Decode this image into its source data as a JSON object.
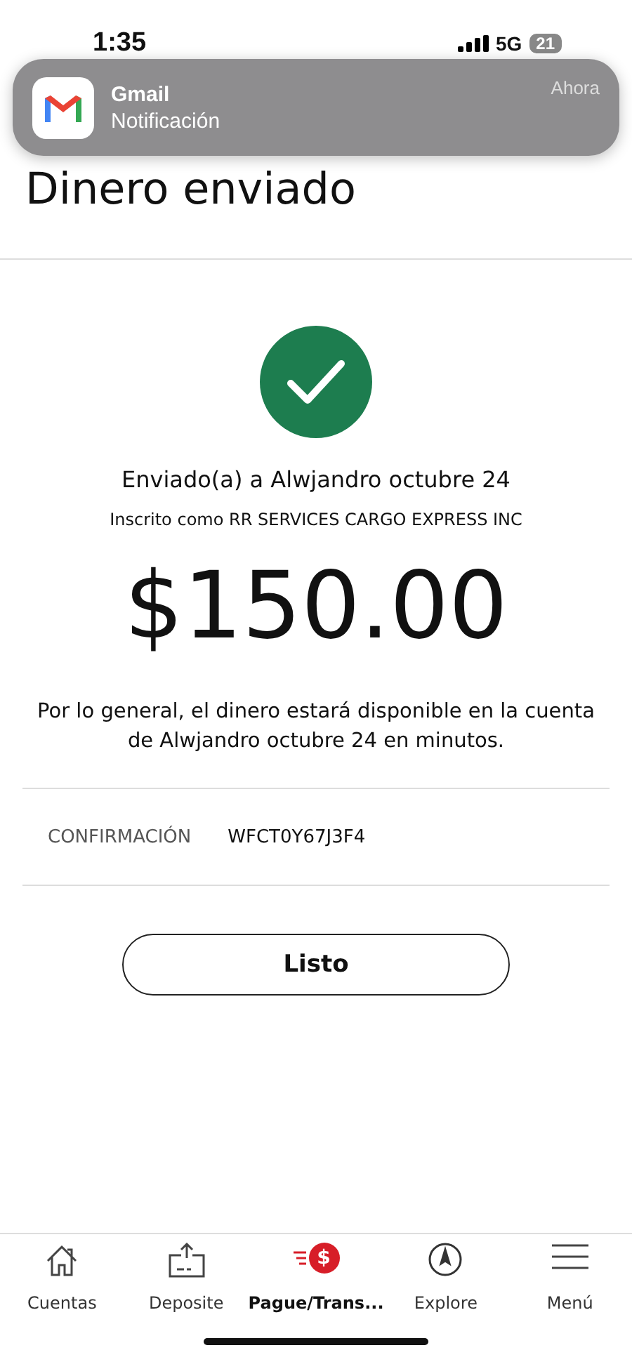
{
  "status_bar": {
    "time": "1:35",
    "network": "5G",
    "battery": "21"
  },
  "notification": {
    "app": "Gmail",
    "text": "Notificación",
    "time": "Ahora"
  },
  "title": "Dinero enviado",
  "recipient": "Enviado(a) a Alwjandro  octubre 24",
  "enrolled": "Inscrito como RR SERVICES CARGO EXPRESS INC",
  "amount": "$150.00",
  "note": "Por lo general, el dinero estará disponible en la cuenta de Alwjandro  octubre 24 en minutos.",
  "confirmation": {
    "label": "CONFIRMACIÓN",
    "value": "WFCT0Y67J3F4"
  },
  "done_button": "Listo",
  "nav": [
    {
      "kind": "home",
      "label": "Cuentas",
      "selected": false
    },
    {
      "kind": "deposit",
      "label": "Deposite",
      "selected": false
    },
    {
      "kind": "pay",
      "label": "Pague/Trans...",
      "badge": "$",
      "selected": true
    },
    {
      "kind": "explore",
      "label": "Explore",
      "selected": false
    },
    {
      "kind": "menu",
      "label": "Menú",
      "selected": false
    }
  ]
}
